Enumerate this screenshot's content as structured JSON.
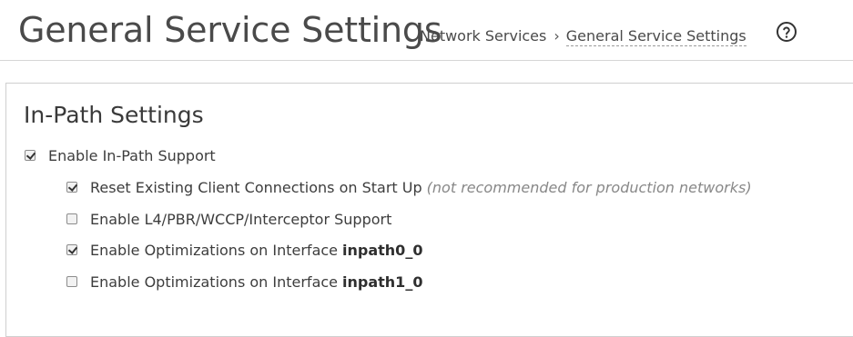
{
  "header": {
    "title": "General Service Settings",
    "breadcrumb": {
      "parent": "Network Services",
      "separator": "›",
      "current": "General Service Settings"
    },
    "help_icon": "question-circle-icon"
  },
  "in_path": {
    "title": "In-Path Settings",
    "enable_support": {
      "label": "Enable In-Path Support",
      "checked": true
    },
    "reset_connections": {
      "label": "Reset Existing Client Connections on Start Up",
      "note": "(not recommended for production networks)",
      "checked": true
    },
    "l4_support": {
      "label": "Enable L4/PBR/WCCP/Interceptor Support",
      "checked": false
    },
    "opt_inpath0": {
      "label": "Enable Optimizations on Interface",
      "interface": "inpath0_0",
      "checked": true
    },
    "opt_inpath1": {
      "label": "Enable Optimizations on Interface",
      "interface": "inpath1_0",
      "checked": false
    }
  },
  "colors": {
    "border": "#cfcfcf",
    "text": "#333333",
    "note": "#888888"
  }
}
